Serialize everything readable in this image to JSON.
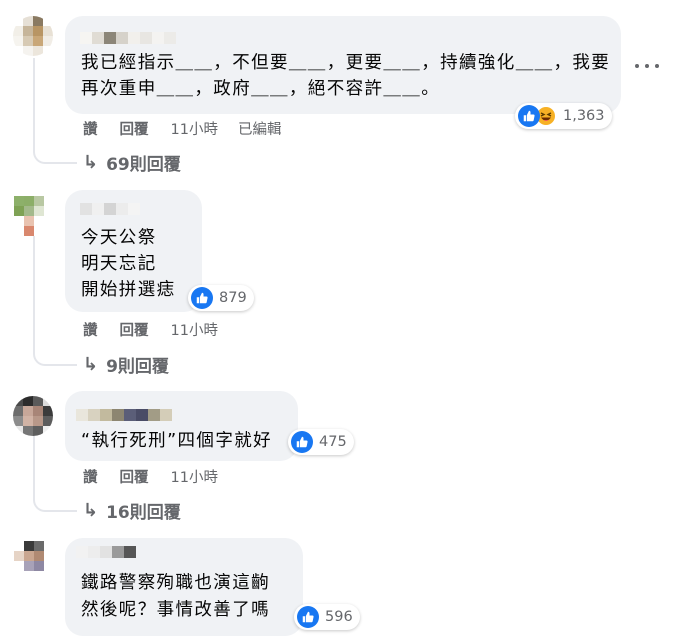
{
  "comments": [
    {
      "text_lines": [
        "我已經指示＿＿，不但要＿＿，更要＿＿，持續強化＿＿，我要",
        "再次重申＿＿，政府＿＿，絕不容許＿＿。"
      ],
      "reactions": [
        "like-icon",
        "haha-icon"
      ],
      "reaction_count": "1,363",
      "actions": {
        "like": "讚",
        "reply": "回覆",
        "time": "11小時",
        "edited": "已編輯"
      },
      "view_replies": "69則回覆"
    },
    {
      "text_lines": [
        "今天公祭",
        "明天忘記",
        "開始拼選痣"
      ],
      "reactions": [
        "like-icon"
      ],
      "reaction_count": "879",
      "actions": {
        "like": "讚",
        "reply": "回覆",
        "time": "11小時"
      },
      "view_replies": "9則回覆"
    },
    {
      "text_lines": [
        "“執行死刑”四個字就好"
      ],
      "reactions": [
        "like-icon"
      ],
      "reaction_count": "475",
      "actions": {
        "like": "讚",
        "reply": "回覆",
        "time": "11小時"
      },
      "view_replies": "16則回覆"
    },
    {
      "text_lines": [
        "鐵路警察殉職也演這齣",
        "然後呢？事情改善了嗎"
      ],
      "reactions": [
        "like-icon"
      ],
      "reaction_count": "596"
    }
  ],
  "icons": {
    "reply_arrow": "reply-arrow-icon",
    "more": "more-options-icon"
  },
  "colors": {
    "like_blue": "#1877f2",
    "haha_yellow": "#f7b125",
    "bubble_bg": "#f0f2f5",
    "meta_gray": "#65676b"
  }
}
